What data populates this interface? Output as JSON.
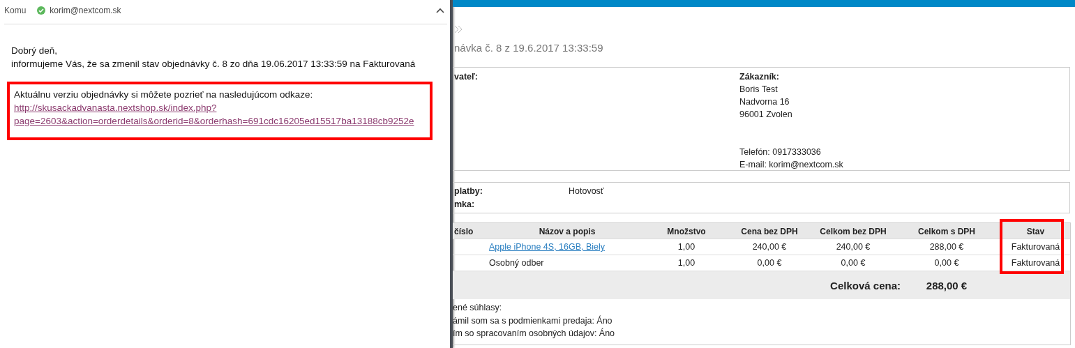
{
  "email": {
    "to_label": "Komu",
    "recipient": {
      "address": "korim@nextcom.sk",
      "verified": true
    },
    "greeting": "Dobrý deň,",
    "message": "informujeme Vás, že sa zmenil stav objednávky č. 8 zo dňa 19.06.2017 13:33:59 na Fakturovaná",
    "link_block": {
      "text": "Aktuálnu verziu objednávky si môžete pozrieť na nasledujúcom odkaze:",
      "link_lines": [
        "http://skusackadvanasta.nextshop.sk/index.php?",
        "page=2603&action=orderdetails&orderid=8&orderhash=691cdc16205ed15517ba13188cb9252e"
      ],
      "highlighted": true
    }
  },
  "order": {
    "title": "návka č. 8 z 19.6.2017 13:33:59",
    "seller_label": "vateľ:",
    "customer": {
      "label": "Zákazník:",
      "lines": [
        "Boris Test",
        "Nadvorna 16",
        "96001 Zvolen"
      ],
      "contact": [
        "Telefón: 0917333036",
        "E-mail: korim@nextcom.sk"
      ]
    },
    "payment": [
      {
        "label": "platby:",
        "value": "Hotovosť"
      },
      {
        "label": "mka:"
      }
    ],
    "table": {
      "columns": [
        {
          "title": "číslo",
          "highlighted": false
        },
        {
          "title": "Názov a popis",
          "highlighted": false
        },
        {
          "title": "Množstvo",
          "highlighted": false
        },
        {
          "title": "Cena bez DPH",
          "highlighted": false
        },
        {
          "title": "Celkom bez DPH",
          "highlighted": false
        },
        {
          "title": "Celkom s DPH",
          "highlighted": false
        },
        {
          "title": "Stav",
          "highlighted": true
        }
      ],
      "rows": [
        {
          "name": "Apple iPhone 4S, 16GB, Biely",
          "kind": "link",
          "quantity": "1,00",
          "price": "240,00 €",
          "total_net": "240,00 €",
          "total_gross": "288,00 €",
          "status": "Fakturovaná"
        },
        {
          "name": "Osobný odber",
          "kind": "text",
          "quantity": "1,00",
          "price": "0,00 €",
          "total_net": "0,00 €",
          "total_gross": "0,00 €",
          "status": "Fakturovaná"
        }
      ],
      "total_label": "Celková cena:",
      "total_value": "288,00 €"
    },
    "consents": [
      "ené súhlasy:",
      "ámil som sa s podmienkami predaja: Áno",
      "ím so spracovaním osobných údajov: Áno"
    ]
  }
}
